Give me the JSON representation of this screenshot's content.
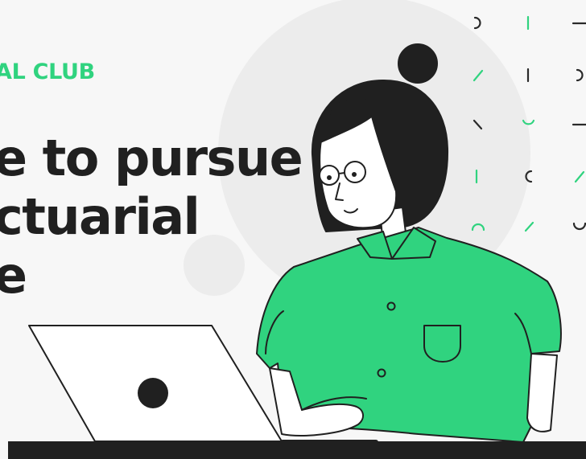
{
  "header": {
    "kicker": "AL CLUB",
    "headline_lines": [
      "e to pursue",
      "ctuarial",
      "e"
    ]
  },
  "colors": {
    "accent": "#30d37f",
    "text": "#202020",
    "background": "#f7f7f7",
    "circle": "#ececec"
  },
  "illustration": {
    "subject": "woman-with-glasses-using-laptop",
    "decoration": "scattered-tick-marks-pattern"
  }
}
